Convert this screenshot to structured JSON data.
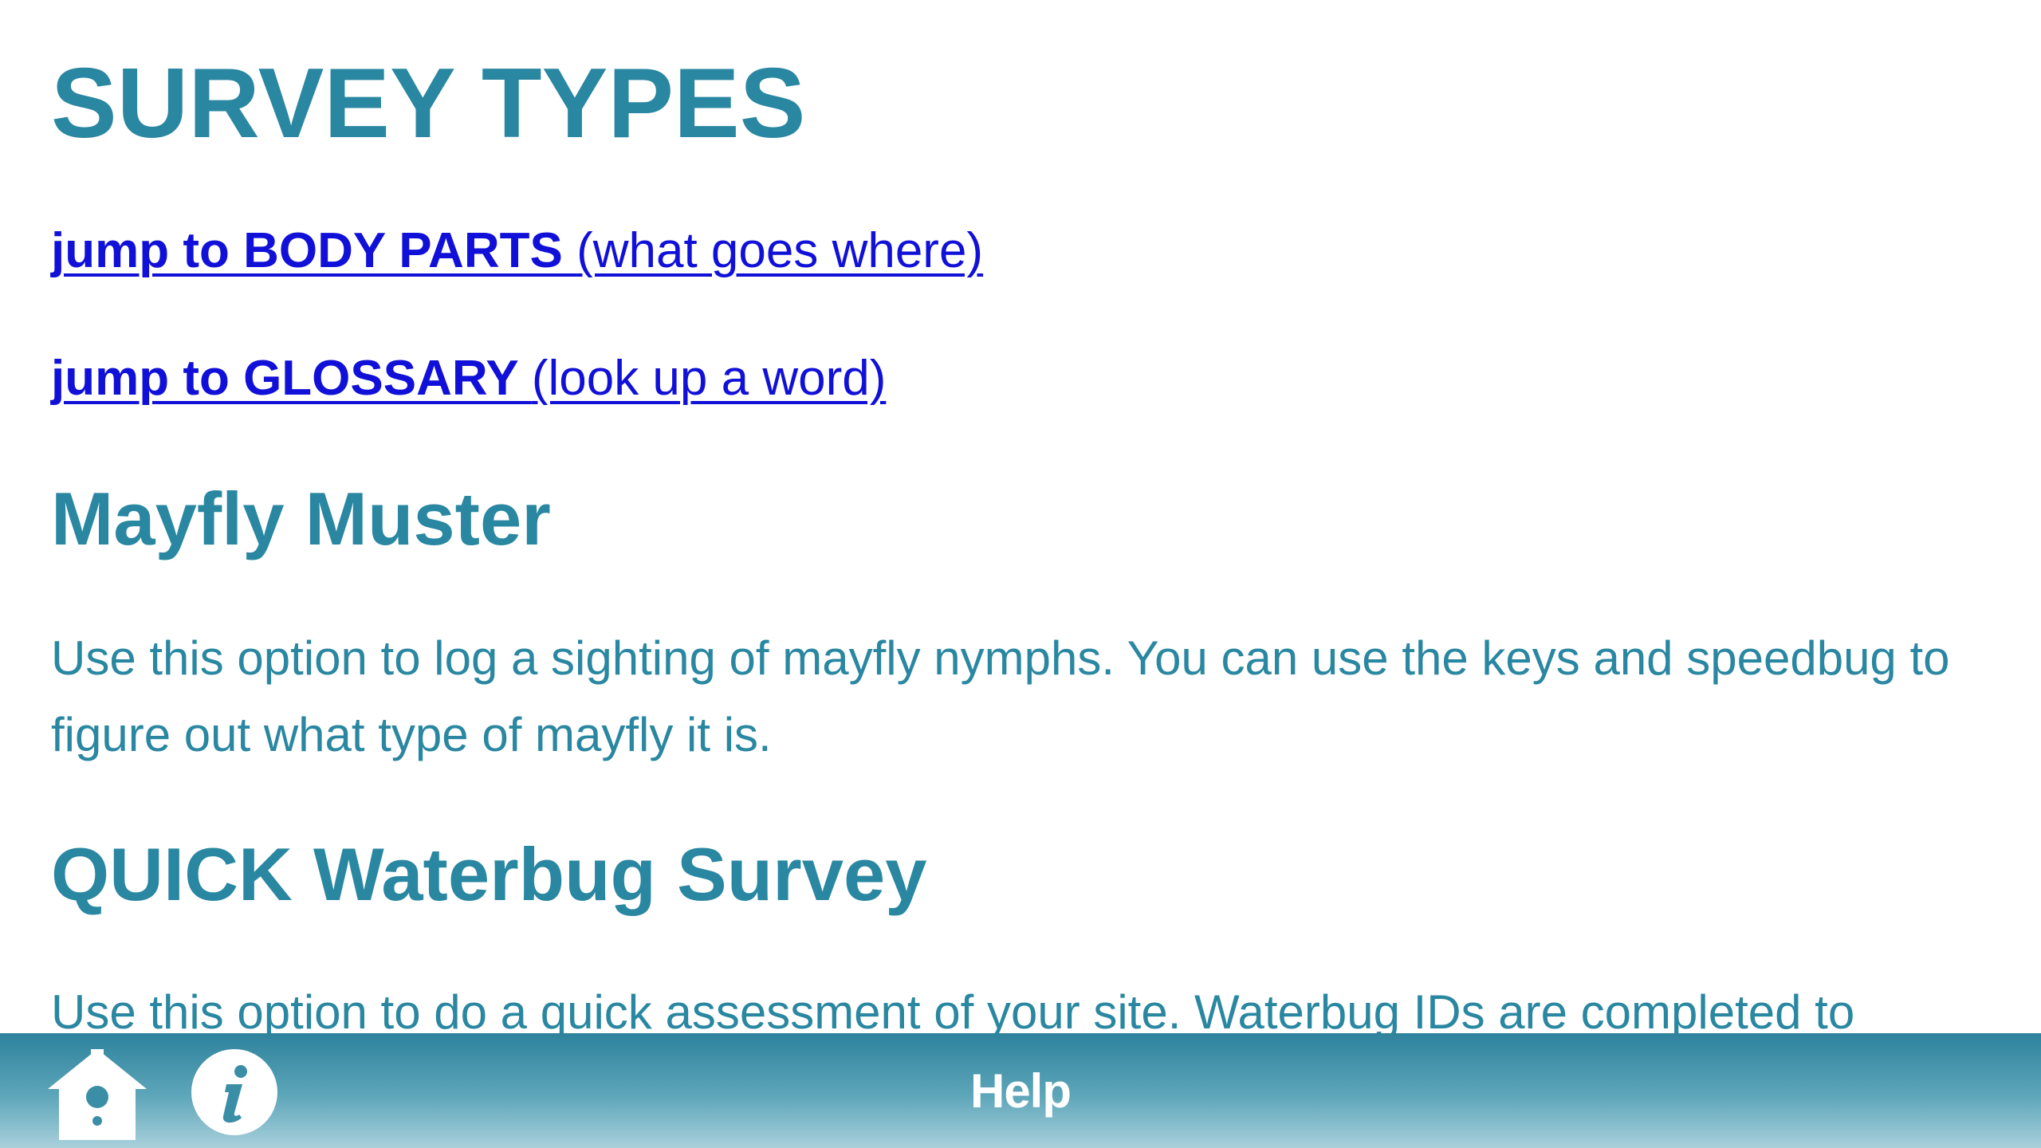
{
  "page": {
    "title": "SURVEY TYPES"
  },
  "links": {
    "body_parts": {
      "bold": "jump to BODY PARTS ",
      "normal": "(what goes where)"
    },
    "glossary": {
      "bold": "jump to GLOSSARY ",
      "normal": "(look up a word)"
    }
  },
  "sections": [
    {
      "heading": "Mayfly Muster",
      "text": "Use this option to log a sighting of mayfly nymphs. You can use the keys and speedbug to figure out what type of mayfly it is."
    },
    {
      "heading": "QUICK Waterbug Survey",
      "text": "Use this option to do a quick assessment of your site. Waterbug IDs are completed to"
    }
  ],
  "footer": {
    "title": "Help",
    "home_icon": "home-icon",
    "info_icon": "info-icon"
  },
  "colors": {
    "accent": "#2a87a1",
    "link": "#1010d8",
    "footer_top": "#2d829c",
    "footer_bottom": "#a9d0db",
    "background": "#ffffff"
  }
}
